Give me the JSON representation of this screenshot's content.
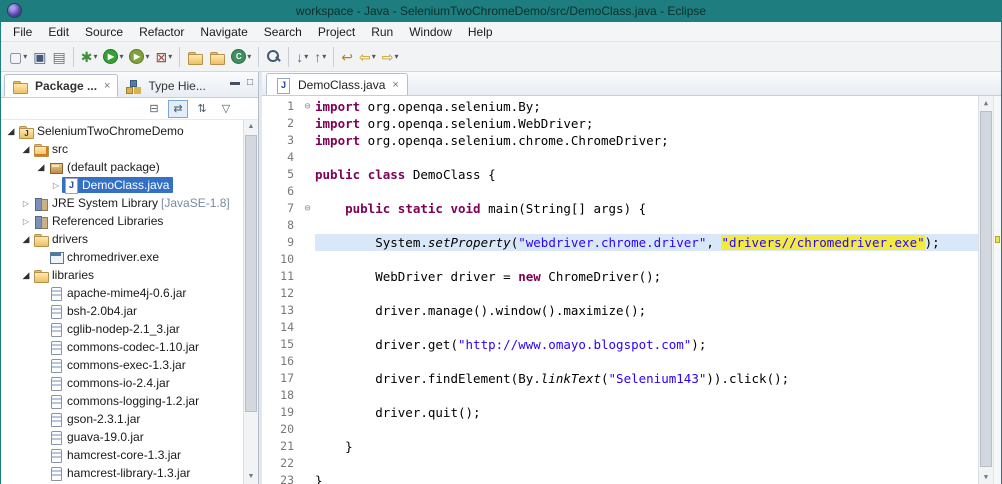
{
  "titlebar": {
    "title": "workspace - Java - SeleniumTwoChromeDemo/src/DemoClass.java - Eclipse"
  },
  "menubar": {
    "items": [
      "File",
      "Edit",
      "Source",
      "Refactor",
      "Navigate",
      "Search",
      "Project",
      "Run",
      "Window",
      "Help"
    ]
  },
  "toolbar": {
    "buttons": [
      {
        "name": "new",
        "glyph": "▢",
        "color": "#6b7a93",
        "dropdown": true
      },
      {
        "name": "save",
        "glyph": "▣",
        "color": "#44597e"
      },
      {
        "name": "print",
        "glyph": "▤",
        "color": "#707070"
      },
      {
        "name": "debug",
        "glyph": "✱",
        "color": "#3f8f3f",
        "dropdown": true,
        "sep_before": true
      },
      {
        "name": "run",
        "glyph": "▶",
        "color": "#35a035",
        "dropdown": true,
        "kind": "circle"
      },
      {
        "name": "coverage",
        "glyph": "▶",
        "color": "#7fa23a",
        "dropdown": true,
        "kind": "circle"
      },
      {
        "name": "external-tools",
        "glyph": "⊠",
        "color": "#9a4a3a",
        "dropdown": true
      },
      {
        "name": "new-java-project",
        "kind": "folder",
        "sep_before": true
      },
      {
        "name": "new-package",
        "kind": "folder"
      },
      {
        "name": "new-class",
        "glyph": "C",
        "color": "#3f8f5f",
        "dropdown": true,
        "kind": "circle"
      },
      {
        "name": "search",
        "kind": "search",
        "sep_before": true
      },
      {
        "name": "next-annotation",
        "glyph": "↓",
        "color": "#5a6a7a",
        "dropdown": true,
        "sep_before": true
      },
      {
        "name": "previous-annotation",
        "glyph": "↑",
        "color": "#5a6a7a",
        "dropdown": true
      },
      {
        "name": "last-edit-location",
        "glyph": "↩",
        "color": "#b8860b",
        "sep_before": true
      },
      {
        "name": "back",
        "glyph": "⇦",
        "color": "#c79810",
        "dropdown": true
      },
      {
        "name": "forward",
        "glyph": "⇨",
        "color": "#c79810",
        "dropdown": true
      }
    ]
  },
  "package_explorer": {
    "tab_package": "Package ...",
    "tab_type_hierarchy": "Type Hie...",
    "view_toolbar": [
      {
        "name": "collapse-all",
        "glyph": "⊟",
        "pressed": false
      },
      {
        "name": "link-with-editor",
        "glyph": "⇄",
        "pressed": true
      },
      {
        "name": "focus-on-active-task",
        "glyph": "⇅",
        "pressed": false
      },
      {
        "name": "view-menu",
        "glyph": "▽",
        "pressed": false
      }
    ],
    "tree": [
      {
        "depth": 0,
        "arrow": "open",
        "icon": "java-project",
        "label": "SeleniumTwoChromeDemo"
      },
      {
        "depth": 1,
        "arrow": "open",
        "icon": "src-folder",
        "label": "src"
      },
      {
        "depth": 2,
        "arrow": "open",
        "icon": "package",
        "label": "(default package)"
      },
      {
        "depth": 3,
        "arrow": "closed",
        "icon": "java-file",
        "label": "DemoClass.java",
        "selected": true
      },
      {
        "depth": 1,
        "arrow": "closed",
        "icon": "library",
        "label": "JRE System Library",
        "suffix": "[JavaSE-1.8]"
      },
      {
        "depth": 1,
        "arrow": "closed",
        "icon": "library",
        "label": "Referenced Libraries"
      },
      {
        "depth": 1,
        "arrow": "open",
        "icon": "folder",
        "label": "drivers"
      },
      {
        "depth": 2,
        "arrow": "none",
        "icon": "exe-file",
        "label": "chromedriver.exe"
      },
      {
        "depth": 1,
        "arrow": "open",
        "icon": "folder",
        "label": "libraries"
      },
      {
        "depth": 2,
        "arrow": "none",
        "icon": "jar",
        "label": "apache-mime4j-0.6.jar"
      },
      {
        "depth": 2,
        "arrow": "none",
        "icon": "jar",
        "label": "bsh-2.0b4.jar"
      },
      {
        "depth": 2,
        "arrow": "none",
        "icon": "jar",
        "label": "cglib-nodep-2.1_3.jar"
      },
      {
        "depth": 2,
        "arrow": "none",
        "icon": "jar",
        "label": "commons-codec-1.10.jar"
      },
      {
        "depth": 2,
        "arrow": "none",
        "icon": "jar",
        "label": "commons-exec-1.3.jar"
      },
      {
        "depth": 2,
        "arrow": "none",
        "icon": "jar",
        "label": "commons-io-2.4.jar"
      },
      {
        "depth": 2,
        "arrow": "none",
        "icon": "jar",
        "label": "commons-logging-1.2.jar"
      },
      {
        "depth": 2,
        "arrow": "none",
        "icon": "jar",
        "label": "gson-2.3.1.jar"
      },
      {
        "depth": 2,
        "arrow": "none",
        "icon": "jar",
        "label": "guava-19.0.jar"
      },
      {
        "depth": 2,
        "arrow": "none",
        "icon": "jar",
        "label": "hamcrest-core-1.3.jar"
      },
      {
        "depth": 2,
        "arrow": "none",
        "icon": "jar",
        "label": "hamcrest-library-1.3.jar"
      }
    ]
  },
  "editor": {
    "tab_label": "DemoClass.java",
    "lines": [
      {
        "n": 1,
        "fold": true,
        "t": [
          [
            "k",
            "import"
          ],
          [
            "p",
            " org.openqa.selenium.By;"
          ]
        ]
      },
      {
        "n": 2,
        "t": [
          [
            "k",
            "import"
          ],
          [
            "p",
            " org.openqa.selenium.WebDriver;"
          ]
        ]
      },
      {
        "n": 3,
        "t": [
          [
            "k",
            "import"
          ],
          [
            "p",
            " org.openqa.selenium.chrome.ChromeDriver;"
          ]
        ]
      },
      {
        "n": 4,
        "t": []
      },
      {
        "n": 5,
        "t": [
          [
            "k",
            "public"
          ],
          [
            "p",
            " "
          ],
          [
            "k",
            "class"
          ],
          [
            "p",
            " DemoClass {"
          ]
        ]
      },
      {
        "n": 6,
        "t": []
      },
      {
        "n": 7,
        "fold": true,
        "t": [
          [
            "p",
            "    "
          ],
          [
            "k",
            "public"
          ],
          [
            "p",
            " "
          ],
          [
            "k",
            "static"
          ],
          [
            "p",
            " "
          ],
          [
            "k",
            "void"
          ],
          [
            "p",
            " main(String[] args) {"
          ]
        ]
      },
      {
        "n": 8,
        "t": []
      },
      {
        "n": 9,
        "cur": true,
        "t": [
          [
            "p",
            "        System."
          ],
          [
            "m",
            "setProperty"
          ],
          [
            "p",
            "("
          ],
          [
            "s",
            "\"webdriver.chrome.driver\""
          ],
          [
            "p",
            ", "
          ],
          [
            "sm",
            "\"drivers//chromedriver.exe\""
          ],
          [
            "p",
            ");"
          ]
        ]
      },
      {
        "n": 10,
        "t": []
      },
      {
        "n": 11,
        "t": [
          [
            "p",
            "        WebDriver driver = "
          ],
          [
            "k",
            "new"
          ],
          [
            "p",
            " ChromeDriver();"
          ]
        ]
      },
      {
        "n": 12,
        "t": []
      },
      {
        "n": 13,
        "t": [
          [
            "p",
            "        driver.manage().window().maximize();"
          ]
        ]
      },
      {
        "n": 14,
        "t": []
      },
      {
        "n": 15,
        "t": [
          [
            "p",
            "        driver.get("
          ],
          [
            "s",
            "\"http://www.omayo.blogspot.com\""
          ],
          [
            "p",
            ");"
          ]
        ]
      },
      {
        "n": 16,
        "t": []
      },
      {
        "n": 17,
        "t": [
          [
            "p",
            "        driver.findElement(By."
          ],
          [
            "m",
            "linkText"
          ],
          [
            "p",
            "("
          ],
          [
            "s",
            "\"Selenium143\""
          ],
          [
            "p",
            ")).click();"
          ]
        ]
      },
      {
        "n": 18,
        "t": []
      },
      {
        "n": 19,
        "t": [
          [
            "p",
            "        driver.quit();"
          ]
        ]
      },
      {
        "n": 20,
        "t": []
      },
      {
        "n": 21,
        "t": [
          [
            "p",
            "    }"
          ]
        ]
      },
      {
        "n": 22,
        "t": []
      },
      {
        "n": 23,
        "t": [
          [
            "p",
            "}"
          ]
        ]
      }
    ]
  },
  "glyphs": {
    "close": "×",
    "minimize": "▬",
    "maximize": "□",
    "dropdown": "▾",
    "fold_expanded": "⊖",
    "arrow_expanded": "◢",
    "arrow_collapsed": "▷",
    "scroll_up": "▲",
    "scroll_down": "▼"
  },
  "colors": {
    "titlebar": "#1e7d7e",
    "keyword": "#7f0055",
    "string": "#2a00ff",
    "occurrence_highlight": "#f3ec3f",
    "current_line": "#d9e8f8",
    "tree_selection": "#3470c4"
  }
}
